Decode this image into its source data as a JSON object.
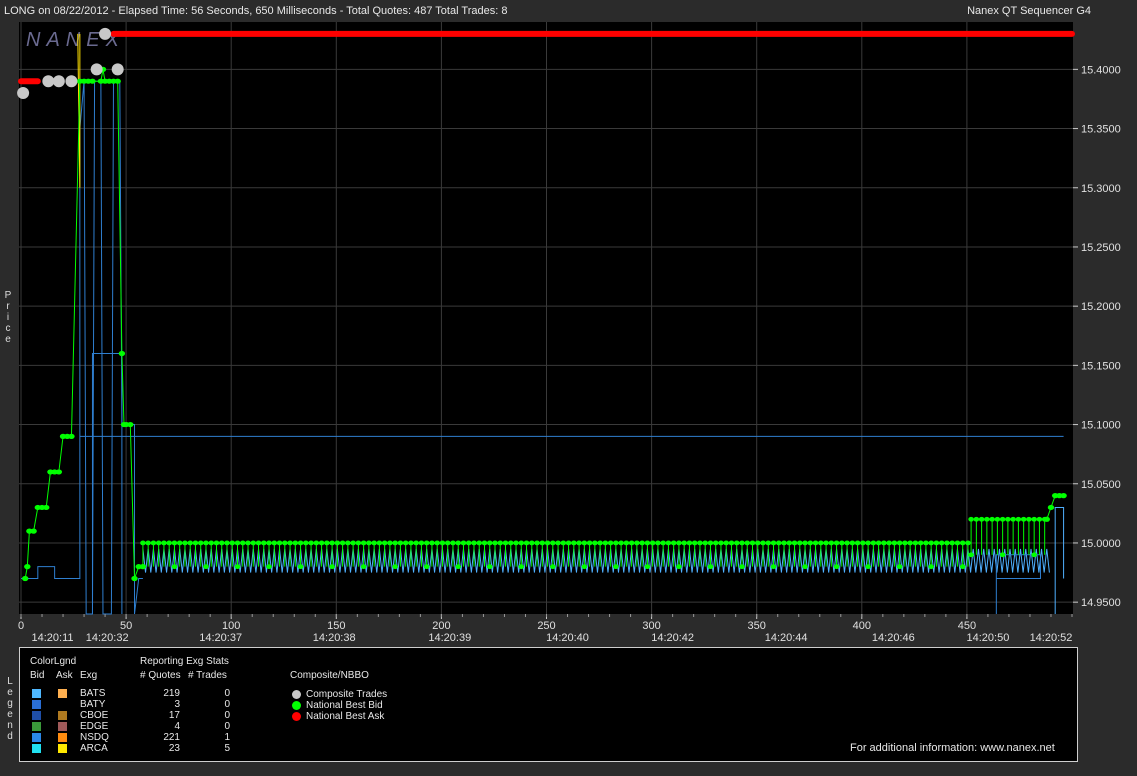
{
  "header": {
    "left_text": "LONG on 08/22/2012  -  Elapsed Time: 56 Seconds, 650 Milliseconds  -  Total Quotes: 487  Total Trades: 8",
    "right_text": "Nanex QT Sequencer G4"
  },
  "watermark": "NANEX",
  "y_axis_label": "Price",
  "legend_side_label": "Legend",
  "colors": {
    "background": "#000000",
    "frame": "#2b2b2b",
    "grid": "#3a3a3a",
    "national_best_bid": "#00ff00",
    "national_best_ask": "#ff0000",
    "composite_trades": "#c8c8c8",
    "quote_line": "#2f7fd0",
    "quote_line_light": "#4fb0ff",
    "trade_line": "#ffe000"
  },
  "chart_data": {
    "type": "line",
    "title": "LONG on 08/22/2012",
    "ylim": [
      14.94,
      15.44
    ],
    "xlim": [
      0,
      500
    ],
    "y_ticks": [
      "15.4000",
      "15.3500",
      "15.3000",
      "15.2500",
      "15.2000",
      "15.1500",
      "15.1000",
      "15.0500",
      "15.0000",
      "14.9500"
    ],
    "y_tick_values": [
      15.4,
      15.35,
      15.3,
      15.25,
      15.2,
      15.15,
      15.1,
      15.05,
      15.0,
      14.95
    ],
    "x_ticks": [
      0,
      50,
      100,
      150,
      200,
      250,
      300,
      350,
      400,
      450
    ],
    "time_labels": [
      {
        "x": 15,
        "label": "14:20:11"
      },
      {
        "x": 41,
        "label": "14:20:32"
      },
      {
        "x": 95,
        "label": "14:20:37"
      },
      {
        "x": 149,
        "label": "14:20:38"
      },
      {
        "x": 204,
        "label": "14:20:39"
      },
      {
        "x": 260,
        "label": "14:20:40"
      },
      {
        "x": 310,
        "label": "14:20:42"
      },
      {
        "x": 364,
        "label": "14:20:44"
      },
      {
        "x": 415,
        "label": "14:20:46"
      },
      {
        "x": 460,
        "label": "14:20:50"
      },
      {
        "x": 490,
        "label": "14:20:52"
      }
    ],
    "series": [
      {
        "name": "National Best Ask",
        "segments": [
          {
            "x": [
              0,
              8
            ],
            "y": 15.39
          },
          {
            "x": [
              44,
              500
            ],
            "y": 15.43
          }
        ]
      },
      {
        "name": "National Best Bid",
        "points": [
          [
            2,
            14.97
          ],
          [
            3,
            14.98
          ],
          [
            4,
            15.01
          ],
          [
            6,
            15.01
          ],
          [
            8,
            15.03
          ],
          [
            10,
            15.03
          ],
          [
            12,
            15.03
          ],
          [
            14,
            15.06
          ],
          [
            16,
            15.06
          ],
          [
            18,
            15.06
          ],
          [
            20,
            15.09
          ],
          [
            22,
            15.09
          ],
          [
            24,
            15.09
          ],
          [
            28,
            15.39
          ],
          [
            30,
            15.39
          ],
          [
            32,
            15.39
          ],
          [
            34,
            15.39
          ],
          [
            38,
            15.39
          ],
          [
            39,
            15.4
          ],
          [
            40,
            15.39
          ],
          [
            42,
            15.39
          ],
          [
            44,
            15.39
          ],
          [
            46,
            15.39
          ],
          [
            48,
            15.16
          ],
          [
            49,
            15.1
          ],
          [
            50,
            15.1
          ],
          [
            52,
            15.1
          ],
          [
            54,
            14.97
          ],
          [
            56,
            14.98
          ],
          [
            58,
            14.98
          ]
        ]
      },
      {
        "name": "National Best Bid (steady band)",
        "band": {
          "x": [
            58,
            452
          ],
          "y_low": 14.98,
          "y_high": 15.0
        }
      },
      {
        "name": "National Best Bid (late band)",
        "band": {
          "x": [
            452,
            488
          ],
          "y_low": 14.99,
          "y_high": 15.02
        }
      },
      {
        "name": "National Best Bid (end)",
        "points": [
          [
            488,
            15.02
          ],
          [
            490,
            15.03
          ],
          [
            492,
            15.04
          ],
          [
            494,
            15.04
          ],
          [
            496,
            15.04
          ]
        ]
      },
      {
        "name": "Composite Trades",
        "points": [
          [
            1,
            15.38
          ],
          [
            13,
            15.39
          ],
          [
            18,
            15.39
          ],
          [
            24,
            15.39
          ],
          [
            36,
            15.4
          ],
          [
            40,
            15.43
          ],
          [
            46,
            15.4
          ]
        ]
      }
    ]
  },
  "legend": {
    "colorlgnd": "ColorLgnd",
    "col_bid": "Bid",
    "col_ask": "Ask",
    "col_exg": "Exg",
    "stats_title": "Reporting Exg Stats",
    "col_quotes": "# Quotes",
    "col_trades": "# Trades",
    "composite_title": "Composite/NBBO",
    "composite_items": [
      {
        "label": "Composite Trades",
        "color": "#c8c8c8"
      },
      {
        "label": "National Best Bid",
        "color": "#00ff00"
      },
      {
        "label": "National Best Ask",
        "color": "#ff0000"
      }
    ],
    "exchanges": [
      {
        "exg": "BATS",
        "bid_color": "#4fb8ff",
        "ask_color": "#ffb050",
        "quotes": "219",
        "trades": "0"
      },
      {
        "exg": "BATY",
        "bid_color": "#2a6fd6",
        "ask_color": "#000000",
        "quotes": "3",
        "trades": "0"
      },
      {
        "exg": "CBOE",
        "bid_color": "#1f4fa8",
        "ask_color": "#b07a20",
        "quotes": "17",
        "trades": "0"
      },
      {
        "exg": "EDGE",
        "bid_color": "#3a9a3a",
        "ask_color": "#a05a5a",
        "quotes": "4",
        "trades": "0"
      },
      {
        "exg": "NSDQ",
        "bid_color": "#2a88e8",
        "ask_color": "#ff8c10",
        "quotes": "221",
        "trades": "1"
      },
      {
        "exg": "ARCA",
        "bid_color": "#20e0f0",
        "ask_color": "#ffe800",
        "quotes": "23",
        "trades": "5"
      }
    ],
    "footer": "For additional information: www.nanex.net"
  }
}
